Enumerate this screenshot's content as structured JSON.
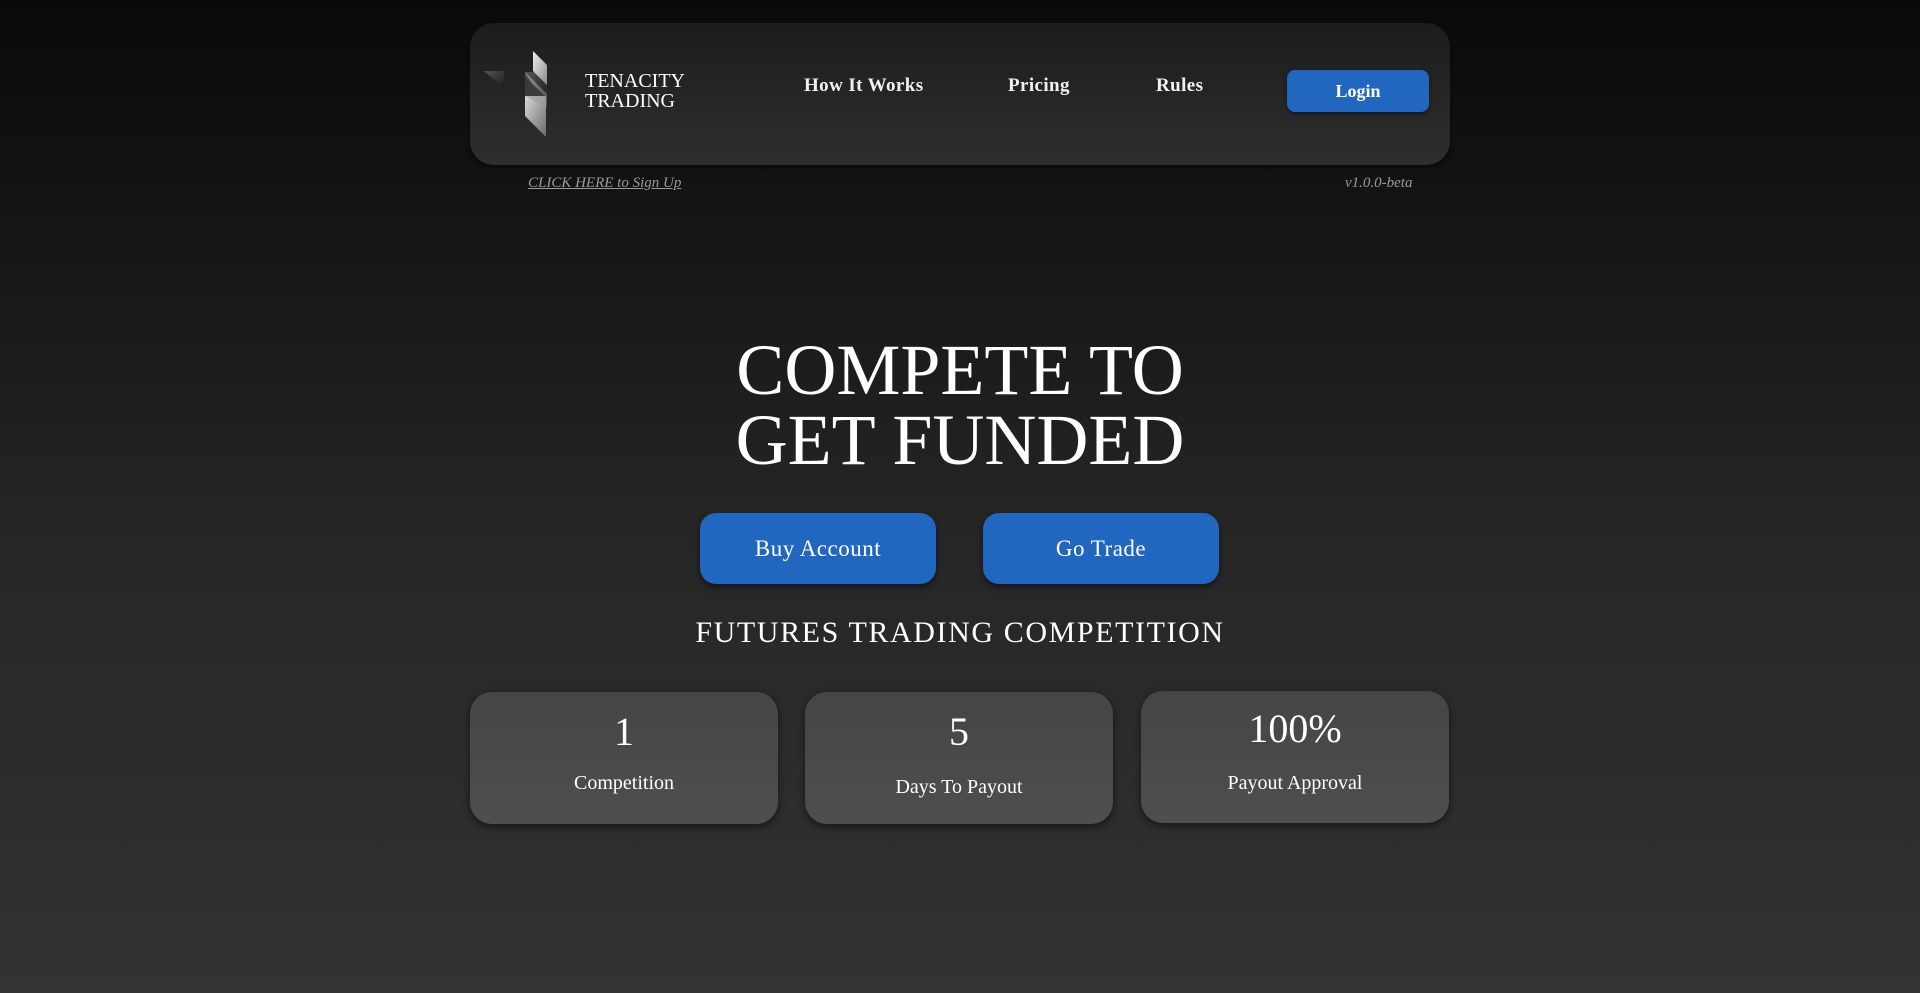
{
  "header": {
    "logo": {
      "icon": "tenacity-logo-icon",
      "line1": "TENACITY",
      "line2": "TRADING"
    },
    "nav": [
      {
        "label": "How It Works"
      },
      {
        "label": "Pricing"
      },
      {
        "label": "Rules"
      }
    ],
    "login_label": "Login"
  },
  "subheader": {
    "signup_label": "CLICK HERE to Sign Up",
    "version": "v1.0.0-beta"
  },
  "hero": {
    "title_line1": "COMPETE TO",
    "title_line2": "GET FUNDED",
    "buy_label": "Buy Account",
    "trade_label": "Go Trade",
    "subtitle": "FUTURES TRADING COMPETITION"
  },
  "stats": [
    {
      "value": "1",
      "label": "Competition"
    },
    {
      "value": "5",
      "label": "Days To Payout"
    },
    {
      "value": "100%",
      "label": "Payout Approval"
    }
  ],
  "colors": {
    "accent": "#2166bf",
    "background_top": "#0a0a0a",
    "background_bottom": "#333333",
    "card": "#4a4a4a",
    "muted_text": "#9a9a9a"
  }
}
